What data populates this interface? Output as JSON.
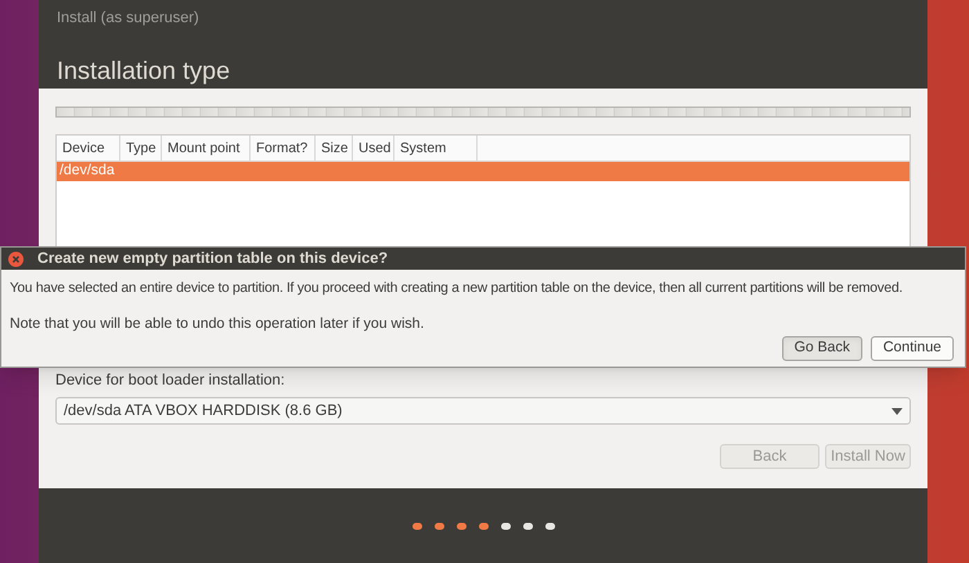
{
  "window": {
    "title": "Install (as superuser)"
  },
  "page_title": "Installation type",
  "table": {
    "columns": [
      "Device",
      "Type",
      "Mount point",
      "Format?",
      "Size",
      "Used",
      "System"
    ],
    "rows": [
      {
        "device": "/dev/sda",
        "selected": true
      }
    ]
  },
  "boot_loader": {
    "label": "Device for boot loader installation:",
    "value": "/dev/sda ATA VBOX HARDDISK (8.6 GB)"
  },
  "buttons": [
    {
      "label": "Back",
      "disabled": true
    },
    {
      "label": "Install Now",
      "disabled": true
    }
  ],
  "progress_dots": [
    {
      "done": true
    },
    {
      "done": true
    },
    {
      "done": true
    },
    {
      "done": true
    },
    {
      "done": false
    },
    {
      "done": false
    },
    {
      "done": false
    }
  ],
  "dialog": {
    "title": "Create new empty partition table on this device?",
    "message": "You have selected an entire device to partition. If you proceed with creating a new partition table on the device, then all current partitions will be removed.",
    "note": "Note that you will be able to undo this operation later if you wish.",
    "buttons": [
      {
        "label": "Go Back",
        "focused": false
      },
      {
        "label": "Continue",
        "focused": true
      }
    ]
  }
}
